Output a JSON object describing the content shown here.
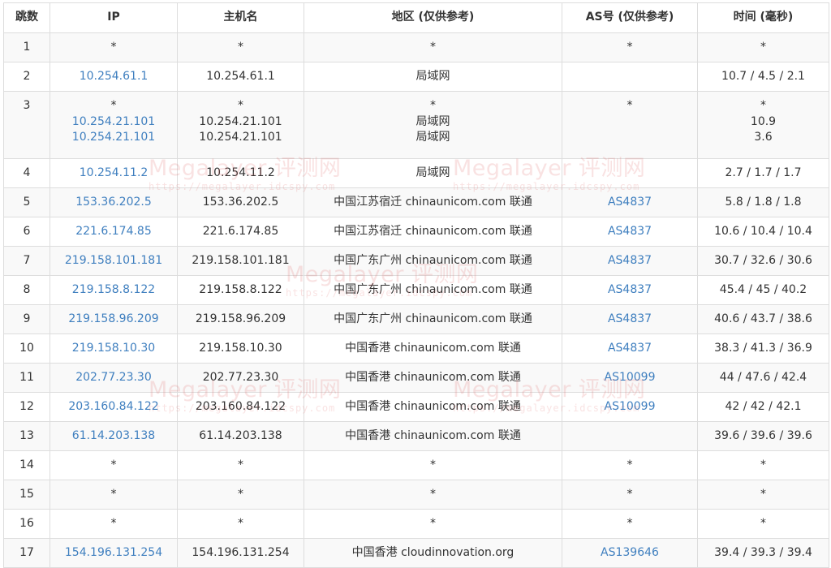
{
  "headers": [
    "跳数",
    "IP",
    "主机名",
    "地区 (仅供参考)",
    "AS号 (仅供参考)",
    "时间 (毫秒)"
  ],
  "rows": [
    {
      "hop": "1",
      "ip": [
        "*"
      ],
      "host": [
        "*"
      ],
      "region": [
        "*"
      ],
      "asn": [
        "*"
      ],
      "time": [
        "*"
      ]
    },
    {
      "hop": "2",
      "ip": [
        "10.254.61.1"
      ],
      "host": [
        "10.254.61.1"
      ],
      "region": [
        "局域网"
      ],
      "asn": [
        ""
      ],
      "time": [
        "10.7 / 4.5 / 2.1"
      ]
    },
    {
      "hop": "3",
      "ip": [
        "*",
        "10.254.21.101",
        "10.254.21.101"
      ],
      "host": [
        "*",
        "10.254.21.101",
        "10.254.21.101"
      ],
      "region": [
        "*",
        "局域网",
        "局域网"
      ],
      "asn": [
        "*"
      ],
      "time": [
        "*",
        "10.9",
        "3.6"
      ]
    },
    {
      "hop": "4",
      "ip": [
        "10.254.11.2"
      ],
      "host": [
        "10.254.11.2"
      ],
      "region": [
        "局域网"
      ],
      "asn": [
        ""
      ],
      "time": [
        "2.7 / 1.7 / 1.7"
      ]
    },
    {
      "hop": "5",
      "ip": [
        "153.36.202.5"
      ],
      "host": [
        "153.36.202.5"
      ],
      "region": [
        "中国江苏宿迁 chinaunicom.com 联通"
      ],
      "asn": [
        "AS4837"
      ],
      "time": [
        "5.8 / 1.8 / 1.8"
      ]
    },
    {
      "hop": "6",
      "ip": [
        "221.6.174.85"
      ],
      "host": [
        "221.6.174.85"
      ],
      "region": [
        "中国江苏宿迁 chinaunicom.com 联通"
      ],
      "asn": [
        "AS4837"
      ],
      "time": [
        "10.6 / 10.4 / 10.4"
      ]
    },
    {
      "hop": "7",
      "ip": [
        "219.158.101.181"
      ],
      "host": [
        "219.158.101.181"
      ],
      "region": [
        "中国广东广州 chinaunicom.com 联通"
      ],
      "asn": [
        "AS4837"
      ],
      "time": [
        "30.7 / 32.6 / 30.6"
      ]
    },
    {
      "hop": "8",
      "ip": [
        "219.158.8.122"
      ],
      "host": [
        "219.158.8.122"
      ],
      "region": [
        "中国广东广州 chinaunicom.com 联通"
      ],
      "asn": [
        "AS4837"
      ],
      "time": [
        "45.4 / 45 / 40.2"
      ]
    },
    {
      "hop": "9",
      "ip": [
        "219.158.96.209"
      ],
      "host": [
        "219.158.96.209"
      ],
      "region": [
        "中国广东广州 chinaunicom.com 联通"
      ],
      "asn": [
        "AS4837"
      ],
      "time": [
        "40.6 / 43.7 / 38.6"
      ]
    },
    {
      "hop": "10",
      "ip": [
        "219.158.10.30"
      ],
      "host": [
        "219.158.10.30"
      ],
      "region": [
        "中国香港 chinaunicom.com 联通"
      ],
      "asn": [
        "AS4837"
      ],
      "time": [
        "38.3 / 41.3 / 36.9"
      ]
    },
    {
      "hop": "11",
      "ip": [
        "202.77.23.30"
      ],
      "host": [
        "202.77.23.30"
      ],
      "region": [
        "中国香港 chinaunicom.com 联通"
      ],
      "asn": [
        "AS10099"
      ],
      "time": [
        "44 / 47.6 / 42.4"
      ]
    },
    {
      "hop": "12",
      "ip": [
        "203.160.84.122"
      ],
      "host": [
        "203.160.84.122"
      ],
      "region": [
        "中国香港 chinaunicom.com 联通"
      ],
      "asn": [
        "AS10099"
      ],
      "time": [
        "42 / 42 / 42.1"
      ]
    },
    {
      "hop": "13",
      "ip": [
        "61.14.203.138"
      ],
      "host": [
        "61.14.203.138"
      ],
      "region": [
        "中国香港 chinaunicom.com 联通"
      ],
      "asn": [
        ""
      ],
      "time": [
        "39.6 / 39.6 / 39.6"
      ]
    },
    {
      "hop": "14",
      "ip": [
        "*"
      ],
      "host": [
        "*"
      ],
      "region": [
        "*"
      ],
      "asn": [
        "*"
      ],
      "time": [
        "*"
      ]
    },
    {
      "hop": "15",
      "ip": [
        "*"
      ],
      "host": [
        "*"
      ],
      "region": [
        "*"
      ],
      "asn": [
        "*"
      ],
      "time": [
        "*"
      ]
    },
    {
      "hop": "16",
      "ip": [
        "*"
      ],
      "host": [
        "*"
      ],
      "region": [
        "*"
      ],
      "asn": [
        "*"
      ],
      "time": [
        "*"
      ]
    },
    {
      "hop": "17",
      "ip": [
        "154.196.131.254"
      ],
      "host": [
        "154.196.131.254"
      ],
      "region": [
        "中国香港 cloudinnovation.org"
      ],
      "asn": [
        "AS139646"
      ],
      "time": [
        "39.4 / 39.3 / 39.4"
      ]
    }
  ],
  "watermarks": [
    {
      "text": "Megalayer 评测网",
      "url": "https://megalayer.idcspy.com"
    },
    {
      "text": "Megalayer 评测网",
      "url": "https://megalayer.idcspy.com"
    },
    {
      "text": "Megalayer 评测网",
      "url": "https://megalayer.idcspy.com"
    },
    {
      "text": "Megalayer 评测网",
      "url": "https://megalayer.idcspy.com"
    },
    {
      "text": "Megalayer 评测网",
      "url": "https://megalayer.idcspy.com"
    }
  ],
  "colors": {
    "link": "#3f7fbf",
    "stripe": "#f9f9f9",
    "border": "#dddddd",
    "watermark": "#e16e6e"
  }
}
